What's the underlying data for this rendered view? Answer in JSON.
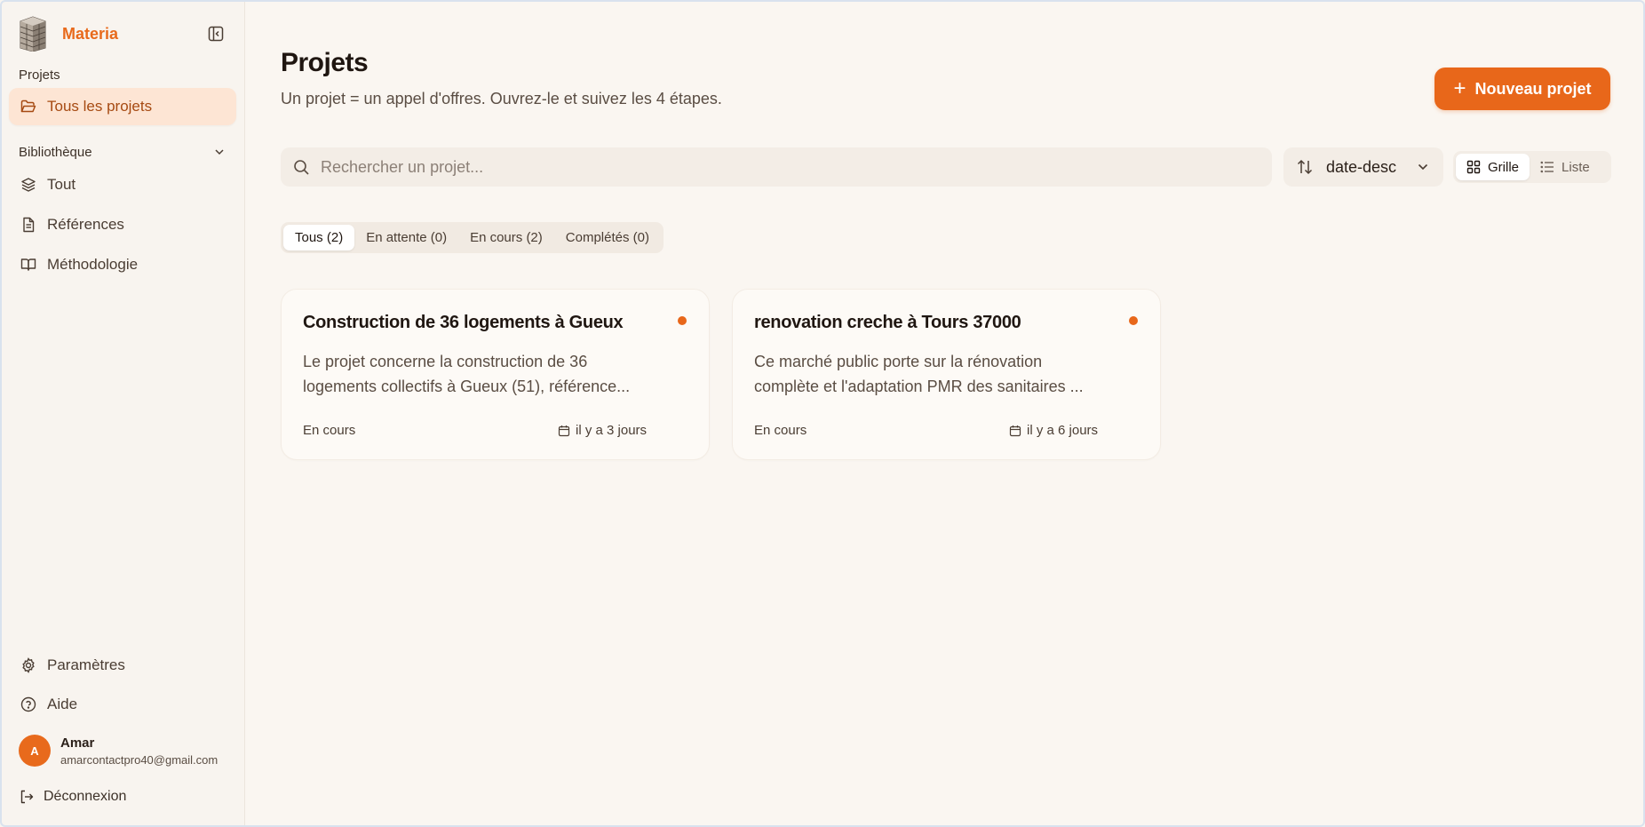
{
  "app": {
    "name": "Materia"
  },
  "sidebar": {
    "projects_label": "Projets",
    "all_projects": "Tous les projets",
    "library_label": "Bibliothèque",
    "library_items": [
      {
        "label": "Tout",
        "icon": "layers-icon"
      },
      {
        "label": "Références",
        "icon": "document-icon"
      },
      {
        "label": "Méthodologie",
        "icon": "book-icon"
      }
    ],
    "settings": "Paramètres",
    "help": "Aide",
    "user": {
      "initial": "A",
      "name": "Amar",
      "email": "amarcontactpro40@gmail.com"
    },
    "logout": "Déconnexion"
  },
  "header": {
    "title": "Projets",
    "subtitle": "Un projet = un appel d'offres. Ouvrez-le et suivez les 4 étapes.",
    "new_button": "Nouveau projet"
  },
  "toolbar": {
    "search_placeholder": "Rechercher un projet...",
    "sort_value": "date-desc",
    "view_grid": "Grille",
    "view_list": "Liste"
  },
  "filters": [
    {
      "label": "Tous (2)",
      "active": true
    },
    {
      "label": "En attente (0)",
      "active": false
    },
    {
      "label": "En cours (2)",
      "active": false
    },
    {
      "label": "Complétés (0)",
      "active": false
    }
  ],
  "projects": [
    {
      "title": "Construction de 36 logements à Gueux",
      "description_line1": "Le projet concerne la construction de 36",
      "description_line2": "logements collectifs à Gueux (51), référence...",
      "status": "En cours",
      "date": "il y a 3 jours"
    },
    {
      "title": "renovation creche à Tours 37000",
      "description_line1": "Ce marché public porte sur la rénovation",
      "description_line2": "complète et l'adaptation PMR des sanitaires ...",
      "status": "En cours",
      "date": "il y a 6 jours"
    }
  ],
  "colors": {
    "accent": "#e8671a",
    "active_bg": "#fde5d4",
    "background": "#faf6f1"
  }
}
